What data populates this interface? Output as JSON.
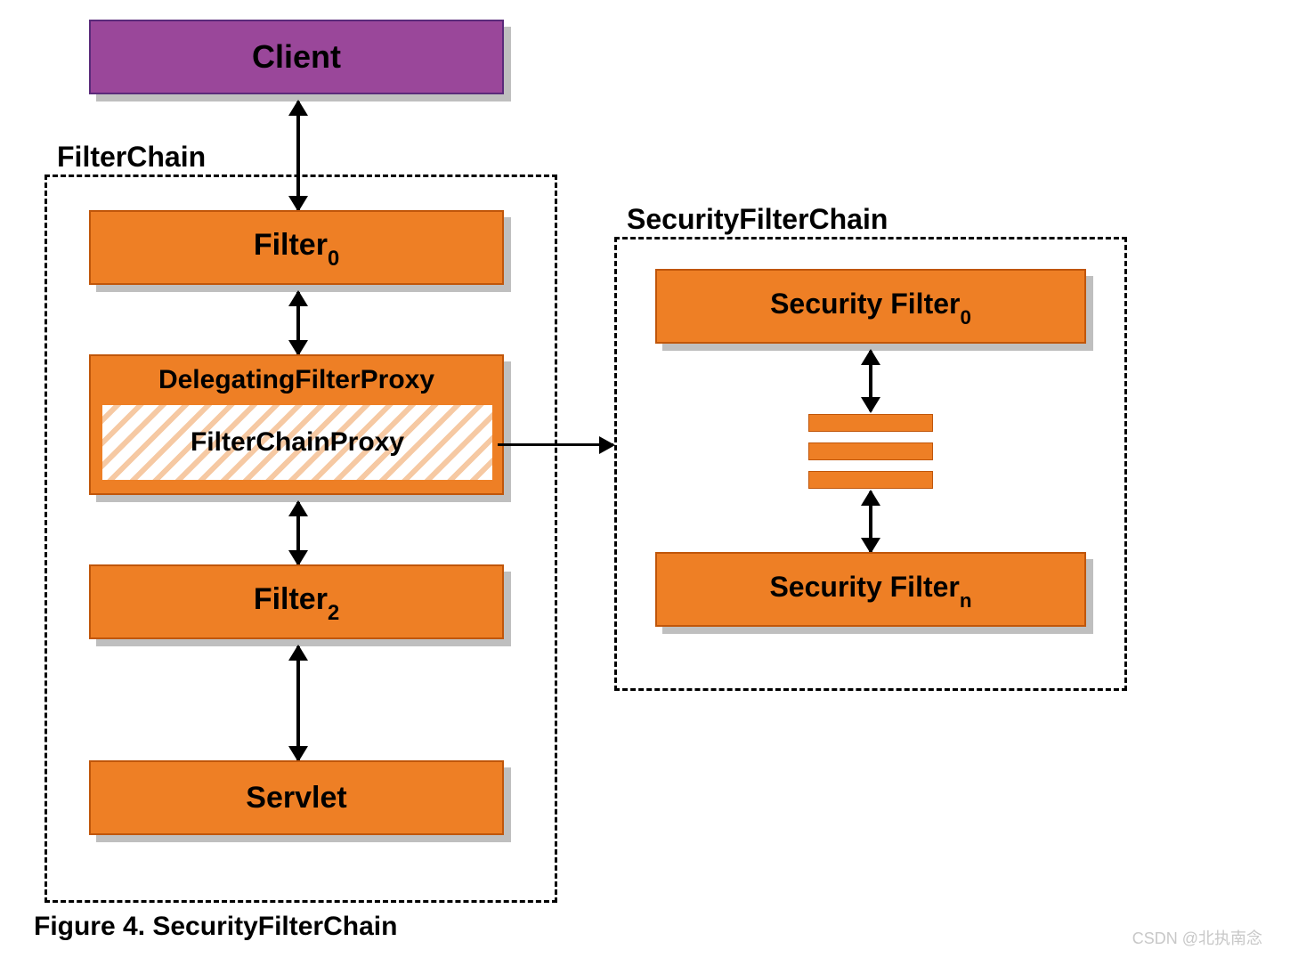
{
  "client": {
    "label": "Client"
  },
  "filter_chain": {
    "label": "FilterChain",
    "filters": [
      {
        "label": "Filter",
        "sub": "0"
      },
      {
        "label": "Filter",
        "sub": "2"
      }
    ],
    "delegating_proxy": {
      "title": "DelegatingFilterProxy",
      "inner": "FilterChainProxy"
    },
    "servlet": {
      "label": "Servlet"
    }
  },
  "security_filter_chain": {
    "label": "SecurityFilterChain",
    "filters": [
      {
        "label": "Security Filter",
        "sub": "0"
      },
      {
        "label": "Security Filter",
        "sub": "n"
      }
    ]
  },
  "caption": "Figure 4. SecurityFilterChain",
  "watermark": "CSDN @北执南念",
  "colors": {
    "orange": "#ee7f25",
    "orange_border": "#c0560a",
    "purple": "#9a479a",
    "purple_border": "#5a2a7a",
    "shadow": "#bfbfbf"
  }
}
